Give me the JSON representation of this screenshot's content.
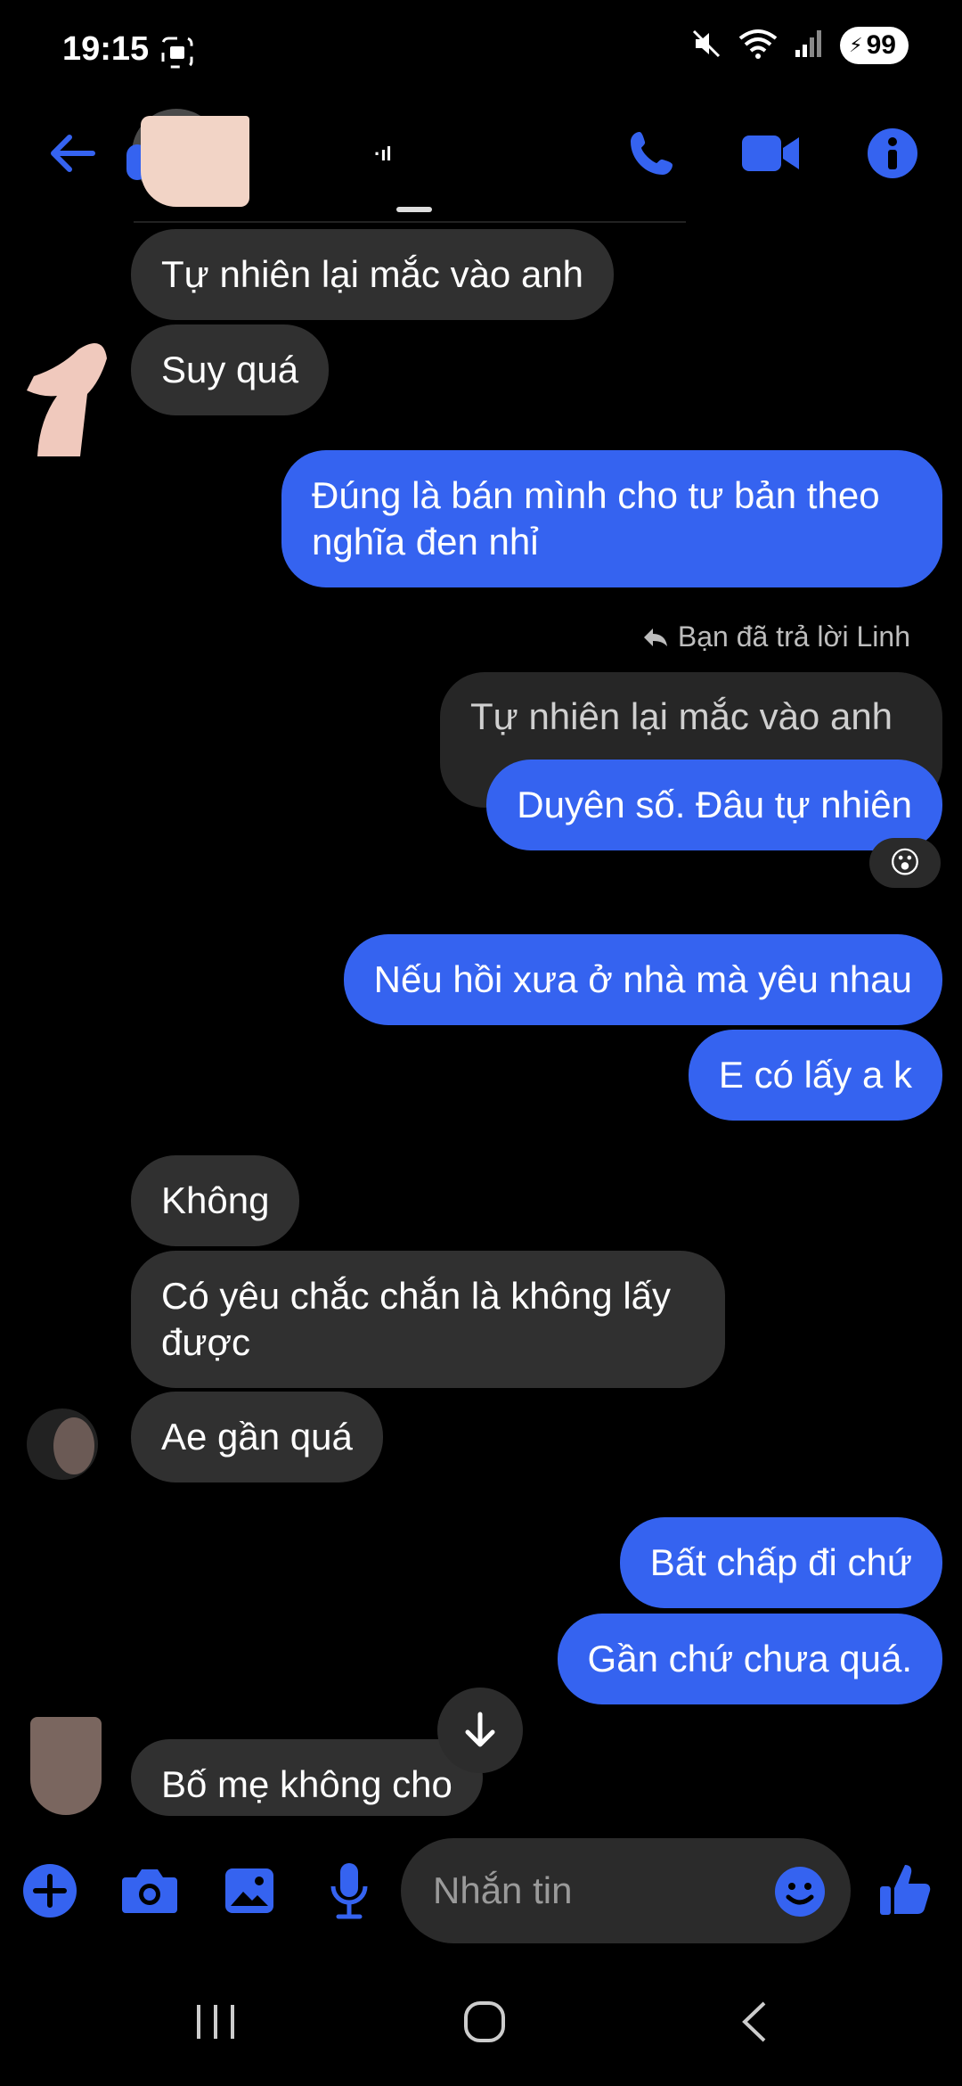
{
  "status_bar": {
    "time": "19:15",
    "battery": "99"
  },
  "header": {
    "contact_name": "·ıl",
    "back_icon": "arrow-left-icon",
    "call_icon": "phone-icon",
    "video_icon": "video-icon",
    "info_icon": "info-icon"
  },
  "messages": [
    {
      "text": "Tự nhiên lại mắc vào anh",
      "side": "in"
    },
    {
      "text": "Suy quá",
      "side": "in"
    },
    {
      "text": "Đúng là bán mình cho tư bản theo\nnghĩa đen nhỉ",
      "side": "out"
    },
    {
      "text": "Tự nhiên lại mắc vào anh",
      "side": "quoted"
    },
    {
      "text": "Duyên số. Đâu tự nhiên",
      "side": "out"
    },
    {
      "text": "Nếu hồi xưa ở nhà mà yêu nhau",
      "side": "out"
    },
    {
      "text": "E có lấy a k",
      "side": "out"
    },
    {
      "text": "Không",
      "side": "in"
    },
    {
      "text": "Có yêu chắc chắn là không lấy\nđược",
      "side": "in"
    },
    {
      "text": "Ae gần quá",
      "side": "in"
    },
    {
      "text": "Bất chấp đi chứ",
      "side": "out"
    },
    {
      "text": "Gần chứ chưa quá.",
      "side": "out"
    },
    {
      "text": "Bố mẹ không cho",
      "side": "in"
    }
  ],
  "reply_note": "Bạn đã trả lời Linh",
  "reaction": "😮",
  "composer": {
    "placeholder": "Nhắn tin"
  },
  "colors": {
    "accent": "#3563f0",
    "incoming_bubble": "#303030",
    "background": "#000000"
  }
}
